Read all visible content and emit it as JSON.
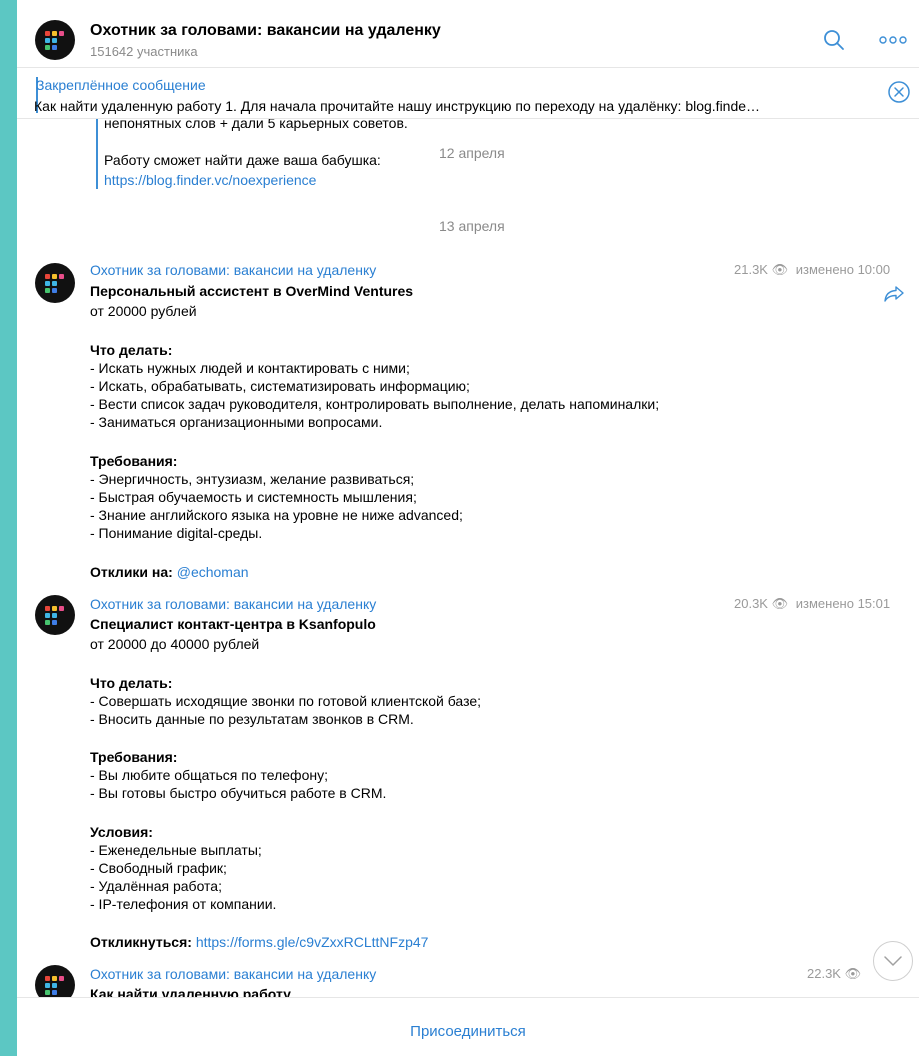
{
  "colors": {
    "accent": "#2a7fd2",
    "background": "#5cc7c3",
    "muted": "#8a8a8a"
  },
  "header": {
    "title": "Охотник за головами: вакансии на удаленку",
    "subtitle": "151642 участника",
    "icons": [
      "search-icon",
      "more-icon"
    ]
  },
  "pinned": {
    "title": "Закреплённое сообщение",
    "text": "Как найти удаленную работу  1. Для начала прочитайте нашу инструкцию по переходу на удалёнку: blog.finde…",
    "icon": "close-circle-icon"
  },
  "feed": {
    "quote": {
      "line1": "непонятных слов + дали 5 карьерных советов.",
      "line2": "Работу сможет найти даже ваша бабушка:",
      "link": "https://blog.finder.vc/noexperience"
    },
    "date1": "12 апреля",
    "date2": "13 апреля",
    "messages": [
      {
        "author": "Охотник за головами: вакансии на удаленку",
        "views": "21.3K",
        "edited": "изменено 10:00",
        "title": "Персональный ассистент в OverMind Ventures",
        "salary": "от 20000 рублей",
        "section1": "Что делать:",
        "items1": [
          "- Искать нужных людей и контактировать с ними;",
          "- Искать, обрабатывать, систематизировать информацию;",
          "- Вести список задач руководителя, контролировать выполнение, делать напоминалки;",
          "- Заниматься организационными вопросами."
        ],
        "section2": "Требования:",
        "items2": [
          "- Энергичность, энтузиазм, желание развиваться;",
          "- Быстрая обучаемость и системность мышления;",
          "- Знание английского языка на уровне не ниже advanced;",
          "- Понимание digital-среды."
        ],
        "reply_label": "Отклики на:",
        "reply_link": "@echoman"
      },
      {
        "author": "Охотник за головами: вакансии на удаленку",
        "views": "20.3K",
        "edited": "изменено 15:01",
        "title": "Специалист контакт-центра в Ksanfopulo",
        "salary": "от 20000 до 40000 рублей",
        "section1": "Что делать:",
        "items1": [
          "- Совершать исходящие звонки по готовой клиентской базе;",
          "- Вносить данные по результатам звонков в CRM."
        ],
        "section2": "Требования:",
        "items2": [
          "- Вы любите общаться по телефону;",
          "- Вы готовы быстро обучиться работе в CRM."
        ],
        "section3": "Условия:",
        "items3": [
          "- Еженедельные выплаты;",
          "- Свободный график;",
          "- Удалённая работа;",
          "- IP-телефония от компании."
        ],
        "reply_label": "Откликнуться:",
        "reply_link": "https://forms.gle/c9vZxxRCLttNFzp47"
      },
      {
        "author": "Охотник за головами: вакансии на удаленку",
        "views": "22.3K",
        "title": "Как найти удаленную работу"
      }
    ]
  },
  "footer": {
    "join_label": "Присоединиться"
  }
}
